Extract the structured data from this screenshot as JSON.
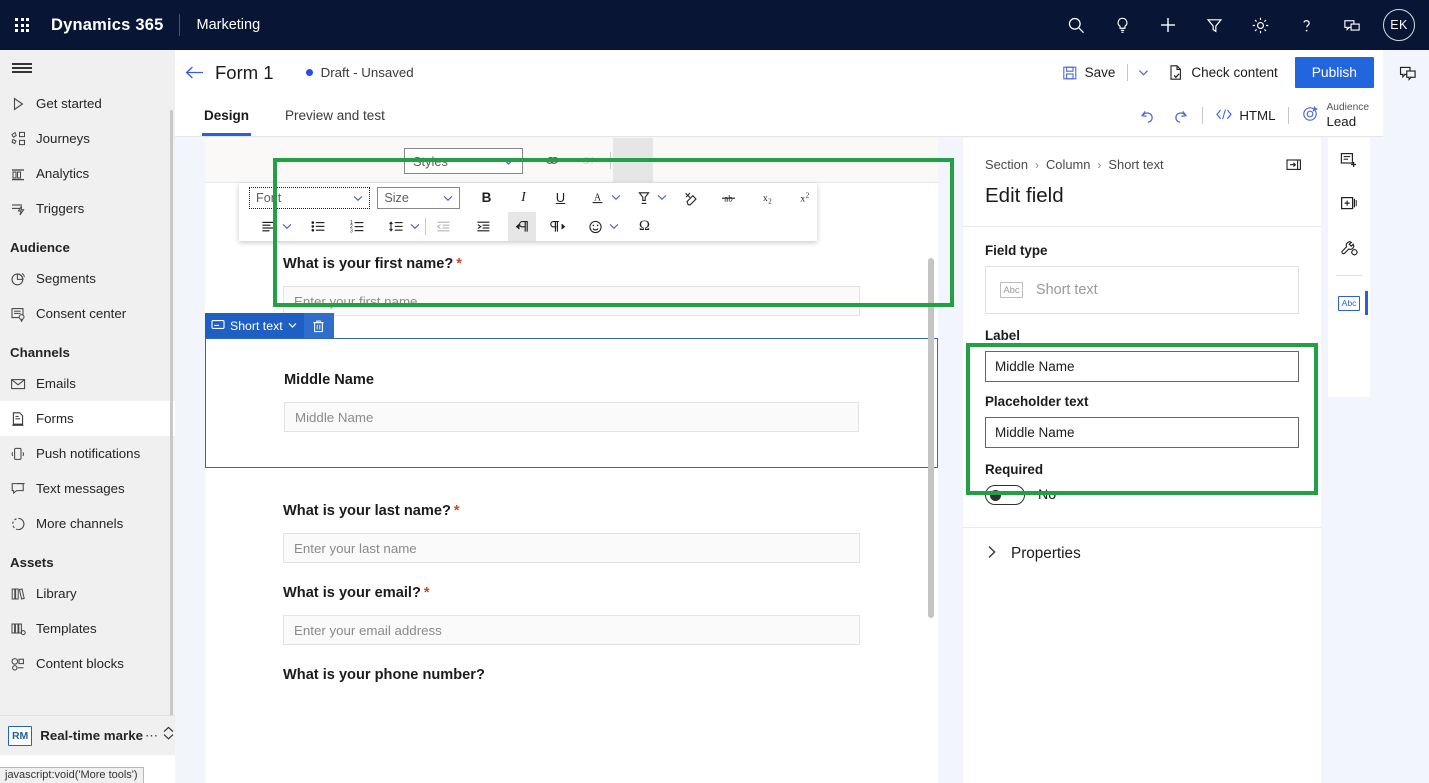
{
  "appbar": {
    "brand": "Dynamics 365",
    "app_name": "Marketing",
    "waffle_icon": "waffle-grid-icon",
    "icons": [
      {
        "name": "search-icon",
        "label": "Search"
      },
      {
        "name": "lightbulb-icon",
        "label": "Insights"
      },
      {
        "name": "plus-icon",
        "label": "New"
      },
      {
        "name": "filter-icon",
        "label": "Filter"
      },
      {
        "name": "gear-icon",
        "label": "Settings"
      },
      {
        "name": "question-icon",
        "label": "Help"
      },
      {
        "name": "chat-icon",
        "label": "Feedback"
      }
    ],
    "avatar_initials": "EK"
  },
  "sidebar": {
    "hamburger_icon": "hamburger-icon",
    "items": [
      {
        "label": "Get started",
        "icon": "play-icon",
        "selected": false
      },
      {
        "label": "Journeys",
        "icon": "journeys-icon",
        "selected": false
      },
      {
        "label": "Analytics",
        "icon": "analytics-icon",
        "selected": false
      },
      {
        "label": "Triggers",
        "icon": "triggers-icon",
        "selected": false
      }
    ],
    "groups": [
      {
        "label": "Audience",
        "items": [
          {
            "label": "Segments",
            "icon": "segments-pie-icon",
            "selected": false
          },
          {
            "label": "Consent center",
            "icon": "consent-icon",
            "selected": false
          }
        ]
      },
      {
        "label": "Channels",
        "items": [
          {
            "label": "Emails",
            "icon": "envelope-icon",
            "selected": false
          },
          {
            "label": "Forms",
            "icon": "forms-icon",
            "selected": true
          },
          {
            "label": "Push notifications",
            "icon": "phone-icon",
            "selected": false
          },
          {
            "label": "Text messages",
            "icon": "sms-bubble-icon",
            "selected": false
          },
          {
            "label": "More channels",
            "icon": "more-channels-icon",
            "selected": false
          }
        ]
      },
      {
        "label": "Assets",
        "items": [
          {
            "label": "Library",
            "icon": "library-icon",
            "selected": false
          },
          {
            "label": "Templates",
            "icon": "templates-icon",
            "selected": false
          },
          {
            "label": "Content blocks",
            "icon": "content-blocks-icon",
            "selected": false
          }
        ]
      }
    ],
    "app_switcher": {
      "badge": "RM",
      "label": "Real-time marketi",
      "dots": "⋯",
      "chevron_icon": "chevron-updown-icon"
    }
  },
  "statusbar": {
    "text": "javascript:void('More tools')"
  },
  "command_bar": {
    "back_icon": "back-arrow-icon",
    "title": "Form 1",
    "status": "Draft - Unsaved",
    "status_dot_color": "#2b4ae8",
    "save_label": "Save",
    "save_icon": "save-disk-icon",
    "save_chevron_icon": "chevron-down-icon",
    "check_content_label": "Check content",
    "check_content_icon": "document-check-icon",
    "publish_label": "Publish",
    "publish_color": "#2266dd"
  },
  "tabs": {
    "items": [
      {
        "label": "Design",
        "active": true
      },
      {
        "label": "Preview and test",
        "active": false
      }
    ],
    "undo_icon": "undo-icon",
    "redo_icon": "redo-icon",
    "html_label": "HTML",
    "html_icon": "code-brackets-icon",
    "audience": {
      "icon": "target-icon",
      "caption": "Audience",
      "value": "Lead"
    }
  },
  "rte_toolbar": {
    "styles_label": "Styles",
    "styles_chevron": "⌄",
    "link_icon": "link-icon",
    "unlink_icon": "unlink-icon",
    "more_label": "···",
    "font_label": "Font",
    "size_label": "Size",
    "row1": [
      {
        "name": "bold-icon",
        "glyph": "B",
        "state": "normal"
      },
      {
        "name": "italic-icon",
        "glyph": "I",
        "state": "normal"
      },
      {
        "name": "underline-icon",
        "glyph": "U",
        "state": "normal"
      },
      {
        "name": "font-color-icon",
        "glyph": "A",
        "state": "normal",
        "has_chevron": true
      },
      {
        "name": "highlight-color-icon",
        "glyph": "marker",
        "state": "normal",
        "has_chevron": true
      },
      {
        "name": "remove-format-icon",
        "glyph": "eraser",
        "state": "normal"
      },
      {
        "name": "strikethrough-icon",
        "glyph": "ab",
        "state": "normal"
      },
      {
        "name": "subscript-icon",
        "glyph": "x2",
        "state": "normal"
      },
      {
        "name": "superscript-icon",
        "glyph": "x2",
        "state": "normal"
      }
    ],
    "row2": [
      {
        "name": "align-left-icon",
        "state": "normal",
        "has_chevron": true
      },
      {
        "name": "bulleted-list-icon",
        "state": "normal"
      },
      {
        "name": "numbered-list-icon",
        "state": "normal"
      },
      {
        "name": "line-spacing-icon",
        "state": "normal",
        "has_chevron": true
      },
      {
        "name": "decrease-indent-icon",
        "state": "disabled"
      },
      {
        "name": "increase-indent-icon",
        "state": "normal"
      },
      {
        "name": "rtl-paragraph-icon",
        "state": "active"
      },
      {
        "name": "ltr-paragraph-icon",
        "state": "normal"
      },
      {
        "name": "emoji-icon",
        "state": "normal",
        "has_chevron": true
      },
      {
        "name": "special-character-icon",
        "glyph": "Ω",
        "state": "normal"
      }
    ]
  },
  "form": {
    "fields": [
      {
        "label": "What is your first name?",
        "required": true,
        "placeholder": "Enter your first name",
        "selected": false
      },
      {
        "label": "Middle Name",
        "required": false,
        "placeholder": "Middle Name",
        "selected": true,
        "badge_label": "Short text",
        "badge_icon": "short-text-icon",
        "badge_chevron": "⌄",
        "delete_icon": "trash-icon",
        "drag_icon": "move-handle-icon"
      },
      {
        "label": "What is your last name?",
        "required": true,
        "placeholder": "Enter your last name",
        "selected": false
      },
      {
        "label": "What is your email?",
        "required": true,
        "placeholder": "Enter your email address",
        "selected": false
      },
      {
        "label": "What is your phone number?",
        "required": false,
        "placeholder": "",
        "selected": false
      }
    ],
    "required_marker": "*"
  },
  "properties_panel": {
    "breadcrumb": [
      "Section",
      "Column",
      "Short text"
    ],
    "breadcrumb_separator": "›",
    "expand_icon": "expand-panel-icon",
    "header": "Edit field",
    "field_type_label": "Field type",
    "field_type_value": "Short text",
    "field_type_icon": "abc-icon",
    "label_label": "Label",
    "label_value": "Middle Name",
    "placeholder_label": "Placeholder text",
    "placeholder_value": "Middle Name",
    "required_label": "Required",
    "required_value": "No",
    "required_on": false,
    "accordion_label": "Properties",
    "accordion_chevron": "›"
  },
  "right_rail": {
    "items": [
      {
        "name": "add-field-icon",
        "active": false
      },
      {
        "name": "add-section-icon",
        "active": false
      },
      {
        "name": "form-settings-icon",
        "active": false
      }
    ],
    "abc_item": {
      "name": "abc-text-icon",
      "glyph": "Abc",
      "active": true
    },
    "accent_color": "#2b5fd9"
  },
  "annotations": {
    "highlight_color": "#21a144",
    "boxes": [
      {
        "name": "rte-toolbar-highlight"
      },
      {
        "name": "label-placeholder-highlight"
      }
    ]
  }
}
